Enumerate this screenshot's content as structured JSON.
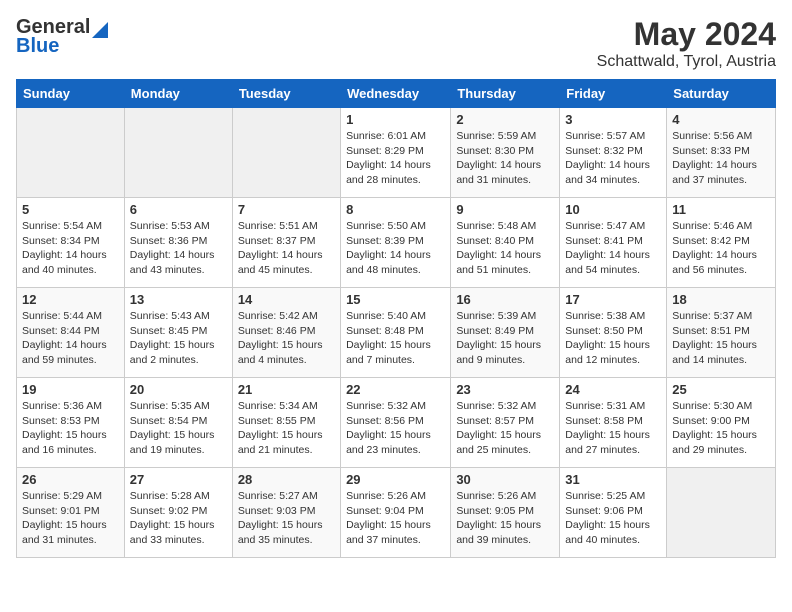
{
  "header": {
    "logo_line1": "General",
    "logo_line2": "Blue",
    "title": "May 2024",
    "subtitle": "Schattwald, Tyrol, Austria"
  },
  "days_of_week": [
    "Sunday",
    "Monday",
    "Tuesday",
    "Wednesday",
    "Thursday",
    "Friday",
    "Saturday"
  ],
  "weeks": [
    [
      {
        "day": "",
        "info": ""
      },
      {
        "day": "",
        "info": ""
      },
      {
        "day": "",
        "info": ""
      },
      {
        "day": "1",
        "info": "Sunrise: 6:01 AM\nSunset: 8:29 PM\nDaylight: 14 hours\nand 28 minutes."
      },
      {
        "day": "2",
        "info": "Sunrise: 5:59 AM\nSunset: 8:30 PM\nDaylight: 14 hours\nand 31 minutes."
      },
      {
        "day": "3",
        "info": "Sunrise: 5:57 AM\nSunset: 8:32 PM\nDaylight: 14 hours\nand 34 minutes."
      },
      {
        "day": "4",
        "info": "Sunrise: 5:56 AM\nSunset: 8:33 PM\nDaylight: 14 hours\nand 37 minutes."
      }
    ],
    [
      {
        "day": "5",
        "info": "Sunrise: 5:54 AM\nSunset: 8:34 PM\nDaylight: 14 hours\nand 40 minutes."
      },
      {
        "day": "6",
        "info": "Sunrise: 5:53 AM\nSunset: 8:36 PM\nDaylight: 14 hours\nand 43 minutes."
      },
      {
        "day": "7",
        "info": "Sunrise: 5:51 AM\nSunset: 8:37 PM\nDaylight: 14 hours\nand 45 minutes."
      },
      {
        "day": "8",
        "info": "Sunrise: 5:50 AM\nSunset: 8:39 PM\nDaylight: 14 hours\nand 48 minutes."
      },
      {
        "day": "9",
        "info": "Sunrise: 5:48 AM\nSunset: 8:40 PM\nDaylight: 14 hours\nand 51 minutes."
      },
      {
        "day": "10",
        "info": "Sunrise: 5:47 AM\nSunset: 8:41 PM\nDaylight: 14 hours\nand 54 minutes."
      },
      {
        "day": "11",
        "info": "Sunrise: 5:46 AM\nSunset: 8:42 PM\nDaylight: 14 hours\nand 56 minutes."
      }
    ],
    [
      {
        "day": "12",
        "info": "Sunrise: 5:44 AM\nSunset: 8:44 PM\nDaylight: 14 hours\nand 59 minutes."
      },
      {
        "day": "13",
        "info": "Sunrise: 5:43 AM\nSunset: 8:45 PM\nDaylight: 15 hours\nand 2 minutes."
      },
      {
        "day": "14",
        "info": "Sunrise: 5:42 AM\nSunset: 8:46 PM\nDaylight: 15 hours\nand 4 minutes."
      },
      {
        "day": "15",
        "info": "Sunrise: 5:40 AM\nSunset: 8:48 PM\nDaylight: 15 hours\nand 7 minutes."
      },
      {
        "day": "16",
        "info": "Sunrise: 5:39 AM\nSunset: 8:49 PM\nDaylight: 15 hours\nand 9 minutes."
      },
      {
        "day": "17",
        "info": "Sunrise: 5:38 AM\nSunset: 8:50 PM\nDaylight: 15 hours\nand 12 minutes."
      },
      {
        "day": "18",
        "info": "Sunrise: 5:37 AM\nSunset: 8:51 PM\nDaylight: 15 hours\nand 14 minutes."
      }
    ],
    [
      {
        "day": "19",
        "info": "Sunrise: 5:36 AM\nSunset: 8:53 PM\nDaylight: 15 hours\nand 16 minutes."
      },
      {
        "day": "20",
        "info": "Sunrise: 5:35 AM\nSunset: 8:54 PM\nDaylight: 15 hours\nand 19 minutes."
      },
      {
        "day": "21",
        "info": "Sunrise: 5:34 AM\nSunset: 8:55 PM\nDaylight: 15 hours\nand 21 minutes."
      },
      {
        "day": "22",
        "info": "Sunrise: 5:32 AM\nSunset: 8:56 PM\nDaylight: 15 hours\nand 23 minutes."
      },
      {
        "day": "23",
        "info": "Sunrise: 5:32 AM\nSunset: 8:57 PM\nDaylight: 15 hours\nand 25 minutes."
      },
      {
        "day": "24",
        "info": "Sunrise: 5:31 AM\nSunset: 8:58 PM\nDaylight: 15 hours\nand 27 minutes."
      },
      {
        "day": "25",
        "info": "Sunrise: 5:30 AM\nSunset: 9:00 PM\nDaylight: 15 hours\nand 29 minutes."
      }
    ],
    [
      {
        "day": "26",
        "info": "Sunrise: 5:29 AM\nSunset: 9:01 PM\nDaylight: 15 hours\nand 31 minutes."
      },
      {
        "day": "27",
        "info": "Sunrise: 5:28 AM\nSunset: 9:02 PM\nDaylight: 15 hours\nand 33 minutes."
      },
      {
        "day": "28",
        "info": "Sunrise: 5:27 AM\nSunset: 9:03 PM\nDaylight: 15 hours\nand 35 minutes."
      },
      {
        "day": "29",
        "info": "Sunrise: 5:26 AM\nSunset: 9:04 PM\nDaylight: 15 hours\nand 37 minutes."
      },
      {
        "day": "30",
        "info": "Sunrise: 5:26 AM\nSunset: 9:05 PM\nDaylight: 15 hours\nand 39 minutes."
      },
      {
        "day": "31",
        "info": "Sunrise: 5:25 AM\nSunset: 9:06 PM\nDaylight: 15 hours\nand 40 minutes."
      },
      {
        "day": "",
        "info": ""
      }
    ]
  ]
}
